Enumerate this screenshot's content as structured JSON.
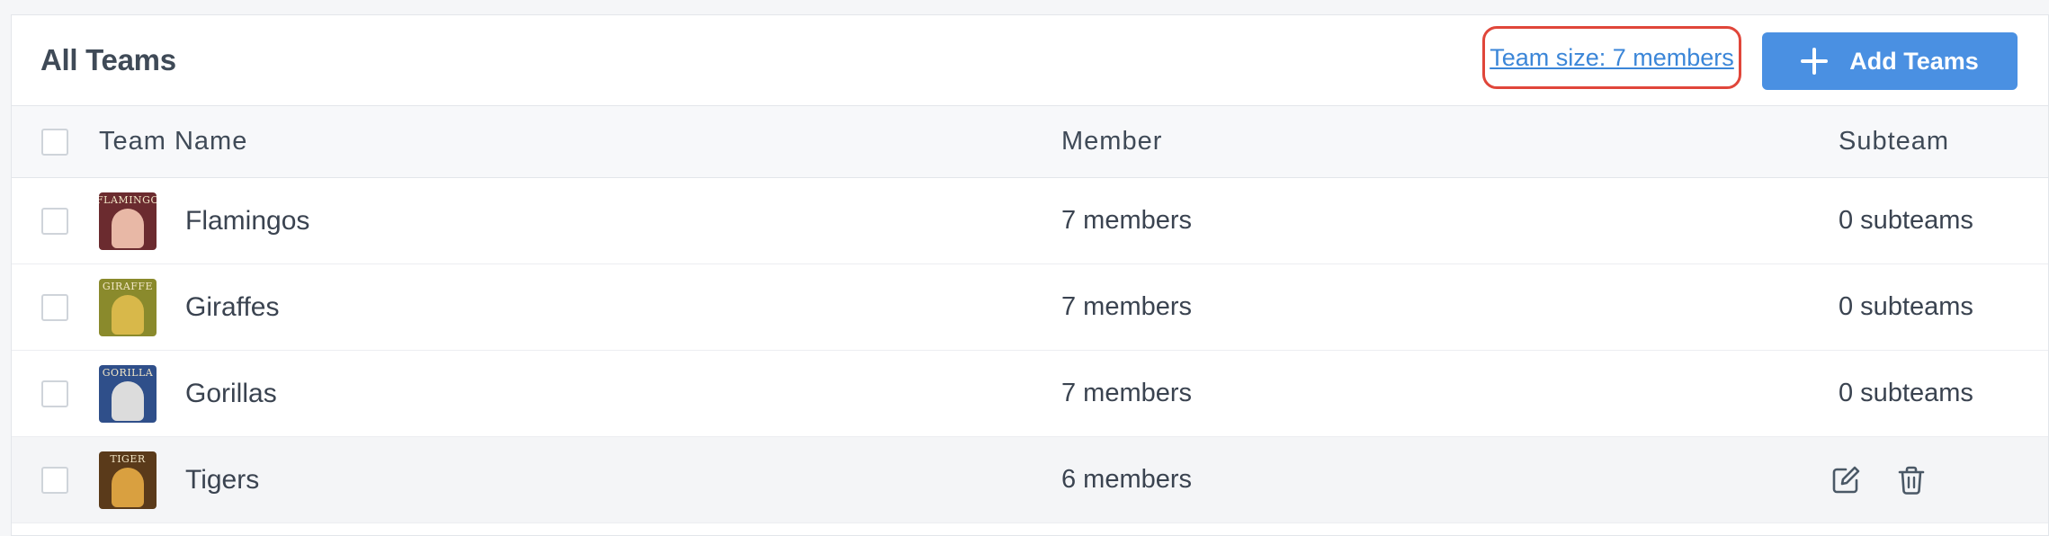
{
  "header": {
    "title": "All Teams",
    "team_size_link": "Team size: 7 members",
    "add_button_label": "Add Teams",
    "add_icon": "plus-icon"
  },
  "columns": {
    "name": "Team Name",
    "member": "Member",
    "subteam": "Subteam"
  },
  "rows": [
    {
      "name": "Flamingos",
      "members": "7 members",
      "subteams": "0 subteams",
      "avatar_label": "FLAMINGO",
      "avatar_bg": "#6b2b2f",
      "avatar_accent": "#e8b8a6"
    },
    {
      "name": "Giraffes",
      "members": "7 members",
      "subteams": "0 subteams",
      "avatar_label": "GIRAFFE",
      "avatar_bg": "#8a8a2c",
      "avatar_accent": "#d8b84a"
    },
    {
      "name": "Gorillas",
      "members": "7 members",
      "subteams": "0 subteams",
      "avatar_label": "GORILLA",
      "avatar_bg": "#2f4f8a",
      "avatar_accent": "#dcdcdc"
    },
    {
      "name": "Tigers",
      "members": "6 members",
      "subteams": "",
      "avatar_label": "TIGER",
      "avatar_bg": "#5a3a1a",
      "avatar_accent": "#d9a040",
      "hovered": true,
      "actions": [
        "edit-icon",
        "trash-icon"
      ]
    }
  ],
  "colors": {
    "accent": "#4a90e2",
    "link": "#3b86d8",
    "highlight_border": "#e0463a"
  }
}
